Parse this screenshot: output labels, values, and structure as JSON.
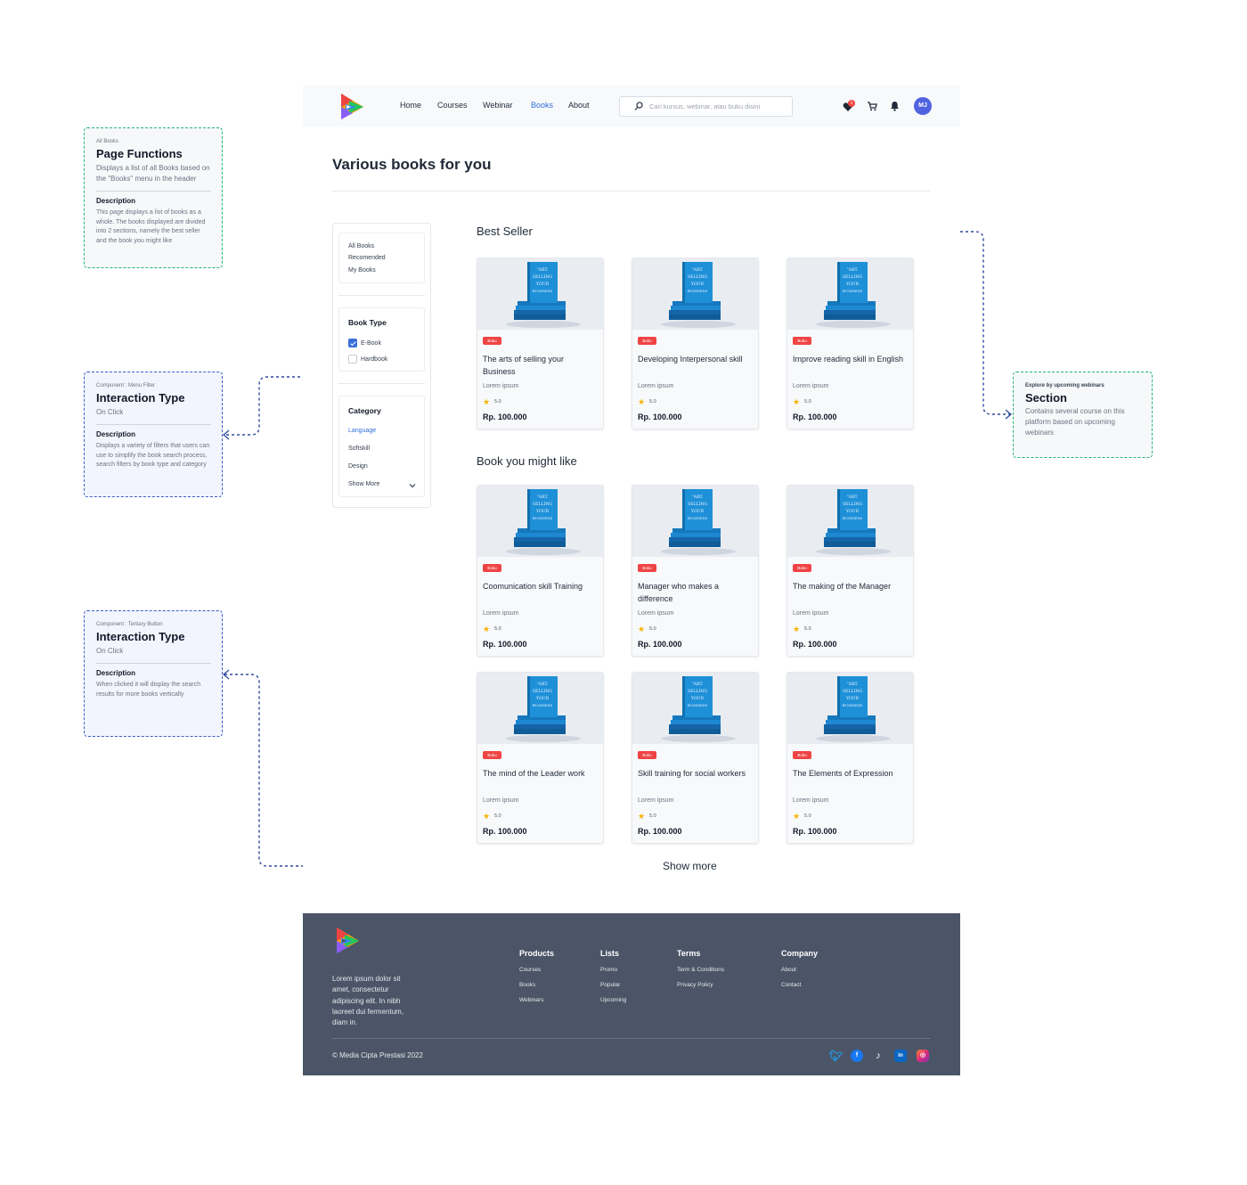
{
  "annotations": {
    "page_functions": {
      "overline": "All Books",
      "title": "Page Functions",
      "subtitle": "Displays a list of all Books based on the \"Books\" menu in the header",
      "desc_heading": "Description",
      "desc_text": "This page displays a list of books as a whole. The books displayed are divided into 2 sections, namely the best seller and the book you might like"
    },
    "menu_filter": {
      "overline": "Component : Menu Filter",
      "title": "Interaction Type",
      "subtitle": "On Click",
      "desc_heading": "Description",
      "desc_text": "Displays a variety of filters that users can use to simplify the book search process, search filters by book type and category"
    },
    "tertiary_button": {
      "overline": "Component : Tertiary Button",
      "title": "Interaction Type",
      "subtitle": "On Click",
      "desc_heading": "Description",
      "desc_text": "When clicked it will display the search results for more books vertically"
    },
    "section": {
      "overline": "Explore by upcoming webinars",
      "title": "Section",
      "subtitle": "Contains several course on this platform based on upcoming webinars"
    }
  },
  "nav": {
    "links": [
      "Home",
      "Courses",
      "Webinar",
      "Books",
      "About"
    ],
    "active": "Books",
    "search_placeholder": "Cari kursus, webinar, atau buku disini",
    "wishlist_badge": "1",
    "avatar_initials": "MJ"
  },
  "page": {
    "title": "Various books for you"
  },
  "filter": {
    "views": [
      "All Books",
      "Recomended",
      "My Books"
    ],
    "book_type_heading": "Book Type",
    "book_types": [
      {
        "label": "E-Book",
        "checked": true
      },
      {
        "label": "Hardbook",
        "checked": false
      }
    ],
    "category_heading": "Category",
    "categories": [
      "Language",
      "Softskill",
      "Design"
    ],
    "show_more": "Show More"
  },
  "sections": {
    "best_seller": "Best Seller",
    "might_like": "Book you might like",
    "show_more": "Show more"
  },
  "cover_text": "\"ART. SELLING YOUR BUSINESS",
  "books": [
    {
      "tag": "Buku",
      "title": "The arts of selling your Business",
      "desc": "Lorem ipsum",
      "rating": "5.0",
      "price": "Rp. 100.000"
    },
    {
      "tag": "Buku",
      "title": "Developing Interpersonal skill",
      "desc": "Lorem ipsum",
      "rating": "5.0",
      "price": "Rp. 100.000"
    },
    {
      "tag": "Buku",
      "title": "Improve reading skill in English",
      "desc": "Lorem ipsum",
      "rating": "5.0",
      "price": "Rp. 100.000"
    },
    {
      "tag": "Buku",
      "title": "Coomunication skill Training",
      "desc": "Lorem ipsum",
      "rating": "5.0",
      "price": "Rp. 100.000"
    },
    {
      "tag": "Buku",
      "title": "Manager who makes a difference",
      "desc": "Lorem ipsum",
      "rating": "5.0",
      "price": "Rp. 100.000"
    },
    {
      "tag": "Buku",
      "title": "The making of the Manager",
      "desc": "Lorem ipsum",
      "rating": "5.0",
      "price": "Rp. 100.000"
    },
    {
      "tag": "Buku",
      "title": "The mind of the Leader work",
      "desc": "Lorem ipsum",
      "rating": "5.0",
      "price": "Rp. 100.000"
    },
    {
      "tag": "Buku",
      "title": "Skill training for social workers",
      "desc": "Lorem ipsum",
      "rating": "5.0",
      "price": "Rp. 100.000"
    },
    {
      "tag": "Buku",
      "title": "The Elements of Expression",
      "desc": "Lorem ipsum",
      "rating": "5.0",
      "price": "Rp. 100.000"
    }
  ],
  "footer": {
    "about": "Lorem ipsum dolor sit amet, consectetur adipiscing elit. In nibh laoreet dui fermentum, diam in.",
    "columns": [
      {
        "heading": "Products",
        "links": [
          "Courses",
          "Books",
          "Webinars"
        ]
      },
      {
        "heading": "Lists",
        "links": [
          "Promo",
          "Popular",
          "Upcoming"
        ]
      },
      {
        "heading": "Terms",
        "links": [
          "Term & Conditions",
          "Privacy Policy"
        ]
      },
      {
        "heading": "Company",
        "links": [
          "About",
          "Contact"
        ]
      }
    ],
    "copyright": "© Media Cipta Prestasi 2022",
    "social": [
      "twitter-icon",
      "facebook-icon",
      "tiktok-icon",
      "linkedin-icon",
      "instagram-icon"
    ]
  },
  "colors": {
    "accent": "#2f6fdc",
    "tag": "#ef4444",
    "footer_bg": "#4b5567",
    "annotation_green": "#22b573",
    "annotation_blue": "#3a5cc7",
    "star": "#f5b301"
  }
}
